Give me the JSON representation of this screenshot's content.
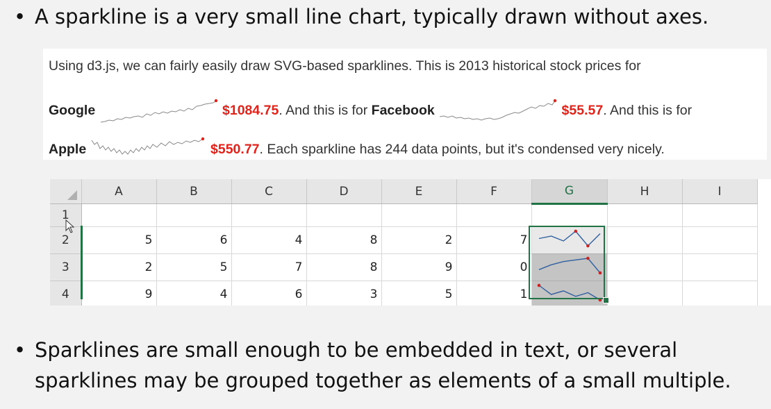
{
  "bullets": {
    "first": "A sparkline is a very small line chart, typically drawn without axes.",
    "second": "Sparklines are small enough to be embedded in text, or several sparklines may be grouped together as elements of a small multiple.",
    "marker": "•"
  },
  "d3_example": {
    "line1": "Using d3.js, we can fairly easily draw SVG-based sparklines. This is 2013 historical stock prices for",
    "google_label": "Google",
    "google_price": "$1084.75",
    "mid1": ". And this is for ",
    "facebook_label": "Facebook",
    "facebook_price": "$55.57",
    "mid2": ". And this is for",
    "apple_label": "Apple",
    "apple_price": "$550.77",
    "end": ". Each sparkline has 244 data points, but it's condensed very nicely.",
    "price_color": "#e0231b"
  },
  "spreadsheet": {
    "columns": [
      "A",
      "B",
      "C",
      "D",
      "E",
      "F",
      "G",
      "H",
      "I"
    ],
    "selected_column": "G",
    "rows": [
      {
        "label": "1",
        "values": [
          "",
          "",
          "",
          "",
          "",
          ""
        ]
      },
      {
        "label": "2",
        "values": [
          "5",
          "6",
          "4",
          "8",
          "2",
          "7"
        ]
      },
      {
        "label": "3",
        "values": [
          "2",
          "5",
          "7",
          "8",
          "9",
          "0"
        ]
      },
      {
        "label": "4",
        "values": [
          "9",
          "4",
          "6",
          "3",
          "5",
          "1"
        ]
      }
    ],
    "accent_color": "#217346",
    "marker_color": "#cc2222"
  }
}
